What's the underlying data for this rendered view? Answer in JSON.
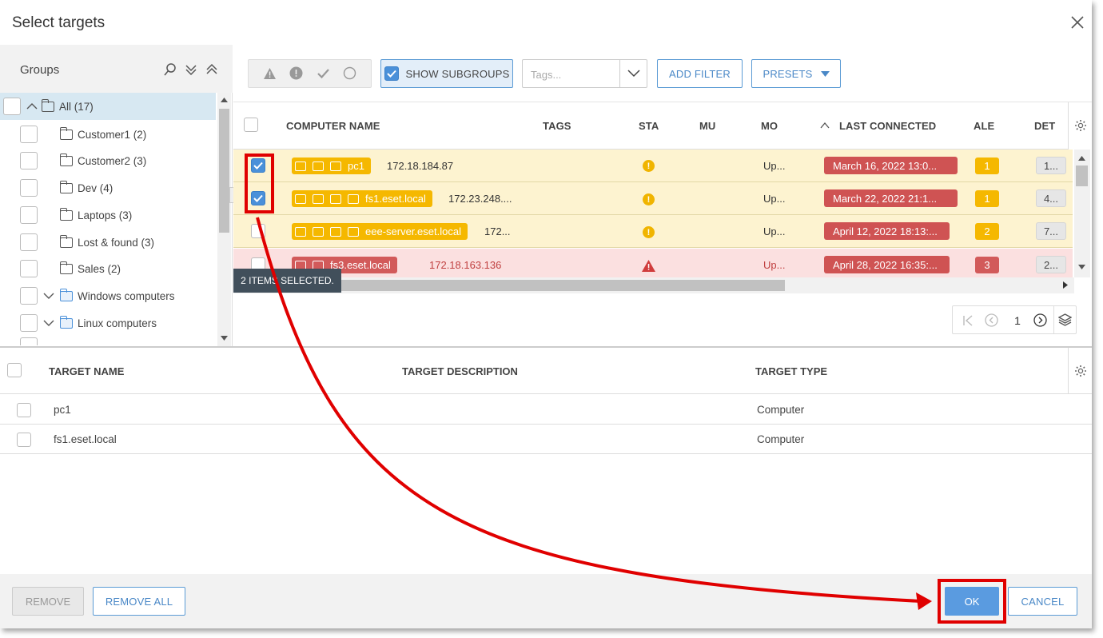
{
  "dialog": {
    "title": "Select targets",
    "close_icon": "close-icon"
  },
  "groups": {
    "title": "Groups",
    "items": [
      {
        "label": "All (17)"
      },
      {
        "label": "Customer1 (2)"
      },
      {
        "label": "Customer2 (3)"
      },
      {
        "label": "Dev (4)"
      },
      {
        "label": "Laptops (3)"
      },
      {
        "label": "Lost & found (3)"
      },
      {
        "label": "Sales (2)"
      },
      {
        "label": "Windows computers"
      },
      {
        "label": "Linux computers"
      }
    ]
  },
  "toolbar": {
    "show_subgroups": "SHOW SUBGROUPS",
    "tags_placeholder": "Tags...",
    "add_filter": "ADD FILTER",
    "presets": "PRESETS"
  },
  "table": {
    "columns": {
      "computer_name": "COMPUTER NAME",
      "tags": "TAGS",
      "status": "STA",
      "muted": "MU",
      "modules": "MO",
      "last_connected": "LAST CONNECTED",
      "alerts": "ALE",
      "detections": "DET"
    },
    "rows": [
      {
        "name": "pc1",
        "ip": "172.18.184.87",
        "modules": "Up...",
        "last_connected": "March 16, 2022 13:0...",
        "alerts": "1",
        "detections": "1...",
        "checked": true
      },
      {
        "name": "fs1.eset.local",
        "ip": "172.23.248....",
        "modules": "Up...",
        "last_connected": "March 22, 2022 21:1...",
        "alerts": "1",
        "detections": "4...",
        "checked": true
      },
      {
        "name": "eee-server.eset.local",
        "ip": "172...",
        "modules": "Up...",
        "last_connected": "April 12, 2022 18:13:...",
        "alerts": "2",
        "detections": "7...",
        "checked": false
      },
      {
        "name": "fs3.eset.local",
        "ip": "172.18.163.136",
        "modules": "Up...",
        "last_connected": "April 28, 2022 16:35:...",
        "alerts": "3",
        "detections": "2...",
        "checked": false
      }
    ],
    "selection_tooltip": "2 ITEMS SELECTED.",
    "page": "1"
  },
  "targets": {
    "columns": {
      "name": "TARGET NAME",
      "description": "TARGET DESCRIPTION",
      "type": "TARGET TYPE"
    },
    "rows": [
      {
        "name": "pc1",
        "description": "",
        "type": "Computer"
      },
      {
        "name": "fs1.eset.local",
        "description": "",
        "type": "Computer"
      }
    ]
  },
  "footer": {
    "remove": "REMOVE",
    "remove_all": "REMOVE ALL",
    "ok": "OK",
    "cancel": "CANCEL"
  },
  "colors": {
    "accent": "#5a9be0",
    "warning_row": "#fdf3d0",
    "critical_row": "#fbe0e0",
    "annotation": "#e00000"
  }
}
